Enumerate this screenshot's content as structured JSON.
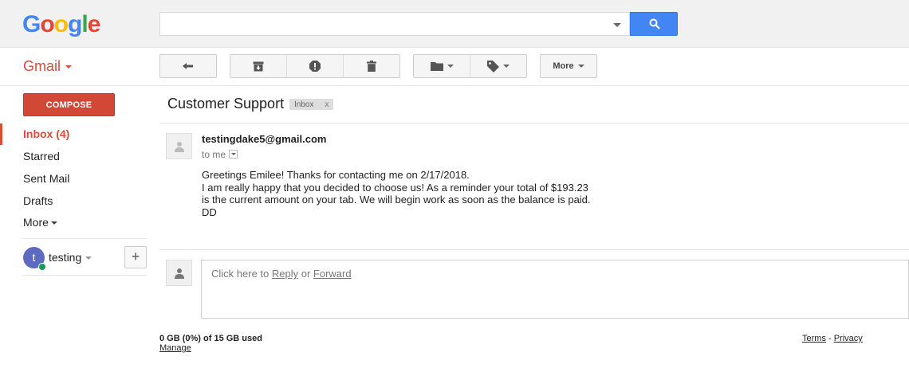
{
  "header": {
    "logo_letters": [
      "G",
      "o",
      "o",
      "g",
      "l",
      "e"
    ],
    "search": {
      "value": "",
      "placeholder": ""
    }
  },
  "app": {
    "label": "Gmail"
  },
  "toolbar": {
    "more_label": "More"
  },
  "sidebar": {
    "compose_label": "COMPOSE",
    "items": [
      {
        "label": "Inbox (4)",
        "active": true
      },
      {
        "label": "Starred",
        "active": false
      },
      {
        "label": "Sent Mail",
        "active": false
      },
      {
        "label": "Drafts",
        "active": false
      },
      {
        "label": "More",
        "active": false
      }
    ],
    "hangouts": {
      "avatar_letter": "t",
      "user": "testing",
      "add_symbol": "+"
    }
  },
  "conversation": {
    "subject": "Customer Support",
    "label_tag": "Inbox",
    "label_tag_close": "x",
    "message": {
      "sender": "testingdake5@gmail.com",
      "to": "to me",
      "body_lines": [
        "Greetings Emilee! Thanks for contacting me on 2/17/2018.",
        "I am really happy that you decided to choose us! As a reminder your total of $193.23",
        "is the current amount on your tab. We will begin work as soon as the balance is paid.",
        "DD"
      ]
    },
    "reply": {
      "prefix": "Click here to ",
      "reply_link": "Reply",
      "or": " or ",
      "forward_link": "Forward"
    }
  },
  "footer": {
    "storage": "0 GB (0%) of 15 GB used",
    "manage": "Manage",
    "terms": "Terms",
    "separator": " - ",
    "privacy": "Privacy"
  },
  "colors": {
    "brand_red": "#dd4b39",
    "search_blue": "#4285f4",
    "online_green": "#0f9d58"
  }
}
